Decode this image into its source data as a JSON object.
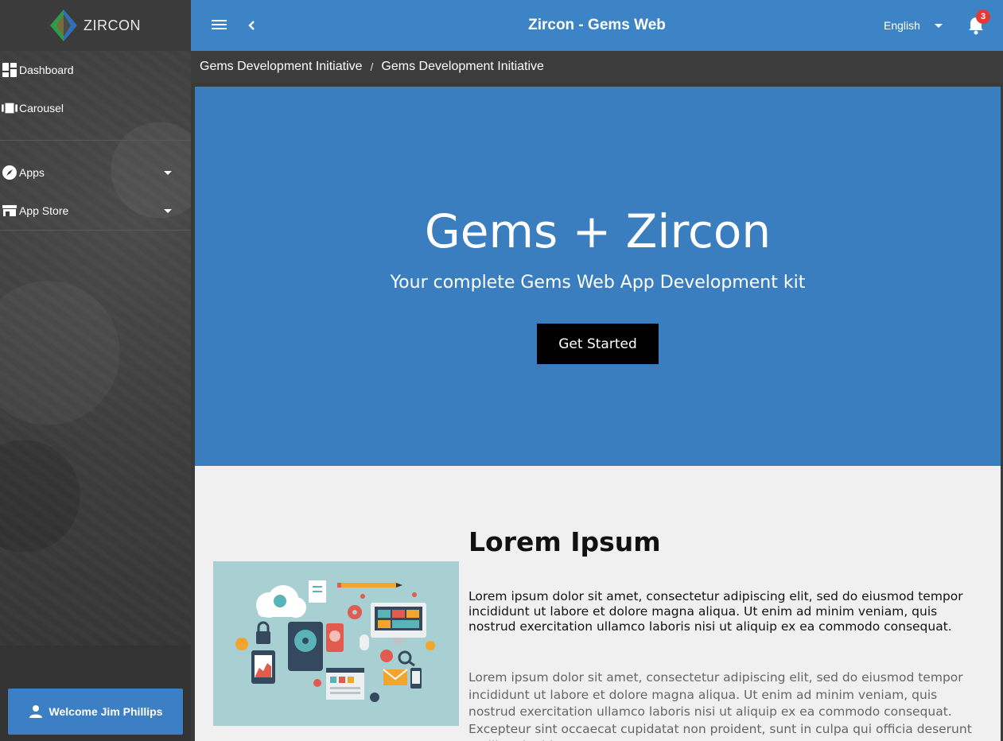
{
  "brand": {
    "name": "ZIRCON",
    "logo_icon": "zircon-gem-logo"
  },
  "sidebar": {
    "items": [
      {
        "label": "Dashboard",
        "icon": "dashboard-icon"
      },
      {
        "label": "Carousel",
        "icon": "carousel-icon"
      },
      {
        "label": "Apps",
        "icon": "compass-icon",
        "expandable": true
      },
      {
        "label": "App Store",
        "icon": "store-icon",
        "expandable": true
      }
    ],
    "welcome_label": "Welcome Jim Phillips"
  },
  "topbar": {
    "title": "Zircon - Gems Web",
    "language": "English",
    "notifications_count": "3"
  },
  "breadcrumb": [
    "Gems Development Initiative",
    "Gems Development Initiative"
  ],
  "breadcrumb_separator": "/",
  "hero": {
    "title": "Gems + Zircon",
    "subtitle": "Your complete Gems Web App Development kit",
    "cta_label": "Get Started"
  },
  "section": {
    "title": "Lorem Ipsum",
    "paragraph1": "Lorem ipsum dolor sit amet, consectetur adipiscing elit, sed do eiusmod tempor incididunt ut labore et dolore magna aliqua. Ut enim ad minim veniam, quis nostrud exercitation ullamco laboris nisi ut aliquip ex ea commodo consequat.",
    "paragraph2": "Lorem ipsum dolor sit amet, consectetur adipiscing elit, sed do eiusmod tempor incididunt ut labore et dolore magna aliqua. Ut enim ad minim veniam, quis nostrud exercitation ullamco laboris nisi ut aliquip ex ea commodo consequat. Excepteur sint occaecat cupidatat non proident, sunt in culpa qui officia deserunt mollit anim id est"
  },
  "colors": {
    "primary": "#3d84c6",
    "hero_bg": "#3b7ec0",
    "sidebar_bg": "#3b3b3b",
    "badge": "#e53935"
  }
}
